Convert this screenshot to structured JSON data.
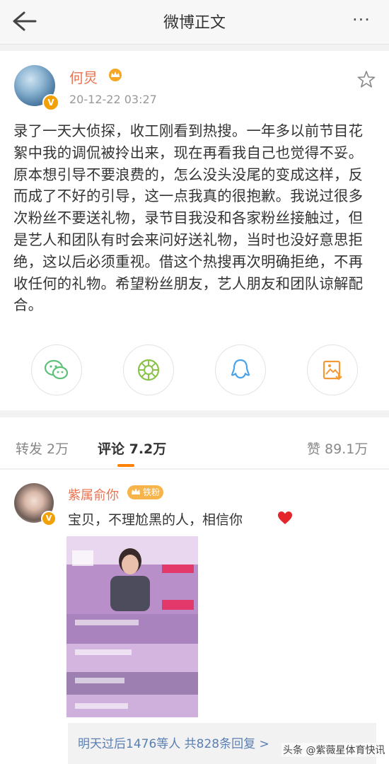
{
  "header": {
    "title": "微博正文",
    "more_icon": "more-dots-icon",
    "back_icon": "back-arrow-icon"
  },
  "post": {
    "author": "何炅",
    "time": "20-12-22 03:27",
    "verified_badge": "V",
    "content": "录了一天大侦探，收工刚看到热搜。一年多以前节目花絮中我的调侃被拎出来，现在再看我自己也觉得不妥。原本想引导不要浪费的，怎么没头没尾的变成这样，反而成了不好的引导，这一点我真的很抱歉。我说过很多次粉丝不要送礼物，录节目我没和各家粉丝接触过，但是艺人和团队有时会来问好送礼物，当时也没好意思拒绝，这以后必须重视。借这个热搜再次明确拒绝，不再收任何的礼物。希望粉丝朋友，艺人朋友和团队谅解配合。",
    "share_icons": [
      "wechat-icon",
      "moments-icon",
      "qq-icon",
      "save-image-icon"
    ]
  },
  "tabs": {
    "repost": "转发 2万",
    "comment": "评论 7.2万",
    "like": "赞 89.1万"
  },
  "comment": {
    "author": "紫属俞你",
    "badge": "铁粉",
    "verified_badge": "V",
    "text": "宝贝，不理尬黑的人，相信你",
    "replies": "明天过后1476等人  共828条回复 >"
  },
  "watermark": "头条 @紫薇星体育快讯",
  "colors": {
    "accent": "#ff8200",
    "name": "#eb7350",
    "link": "#5a7fb3"
  }
}
